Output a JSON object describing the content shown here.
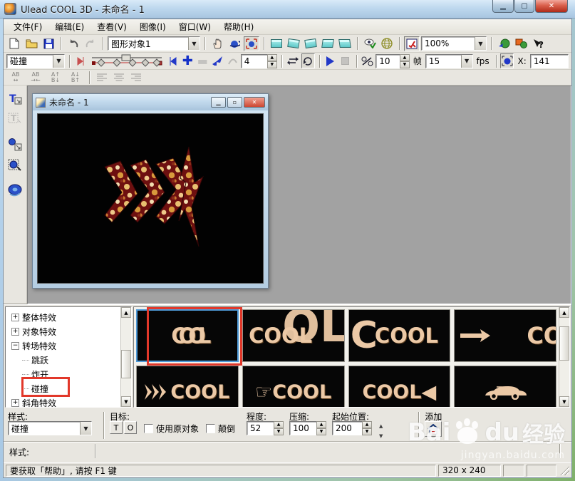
{
  "window": {
    "title": "Ulead COOL 3D - 未命名 - 1"
  },
  "menu": [
    "文件(F)",
    "编辑(E)",
    "查看(V)",
    "图像(I)",
    "窗口(W)",
    "帮助(H)"
  ],
  "toolbar_main": {
    "object_selector": "图形对象1",
    "zoom_selector": "100%"
  },
  "toolbar_anim": {
    "effect_selector": "碰撞",
    "keyframe_count": "4",
    "frame_value": "10",
    "frame_unit": "帧",
    "fps_value": "15",
    "fps_unit": "fps",
    "x_label": "X:",
    "x_value": "141"
  },
  "child_window": {
    "title": "未命名 - 1"
  },
  "effects_tree": {
    "items": [
      {
        "label": "整体特效"
      },
      {
        "label": "对象特效"
      },
      {
        "label": "转场特效"
      },
      {
        "label": "跳跃"
      },
      {
        "label": "炸开"
      },
      {
        "label": "碰撞"
      },
      {
        "label": "斜角特效"
      }
    ]
  },
  "gallery": {
    "thumbs": [
      {
        "text": "COOL"
      },
      {
        "text": "COOL",
        "overlay": "OL"
      },
      {
        "text": "COOL",
        "prefix": "C"
      },
      {
        "text": "CO"
      },
      {
        "text": "COOL"
      },
      {
        "text": "COOL",
        "prefix": "☞"
      },
      {
        "text": "COOL",
        "suffix": "◀"
      },
      {
        "text": ""
      }
    ]
  },
  "controls": {
    "style_label": "样式:",
    "style_value": "碰撞",
    "target_label": "目标:",
    "target_t": "T",
    "target_o": "O",
    "use_original_label": "使用原对象",
    "flip_label": "颠倒",
    "degree_label": "程度:",
    "degree_value": "52",
    "compress_label": "压缩:",
    "compress_value": "100",
    "start_label": "起始位置:",
    "start_value": "200",
    "add_label": "添加"
  },
  "style_row": {
    "label": "样式:"
  },
  "statusbar": {
    "help_text": "要获取「帮助」, 请按 F1 键",
    "size_text": "320 x 240"
  },
  "watermark": {
    "brand_left": "Bai",
    "brand_right": "du",
    "suffix": "经验",
    "url": "jingyan.baidu.com"
  },
  "colors": {
    "accent_blue": "#2238c8",
    "selection_blue": "#4e9ad8",
    "annotation_red": "#e2382a",
    "canvas_black": "#020202",
    "cool_text": "#ecc9a6"
  }
}
